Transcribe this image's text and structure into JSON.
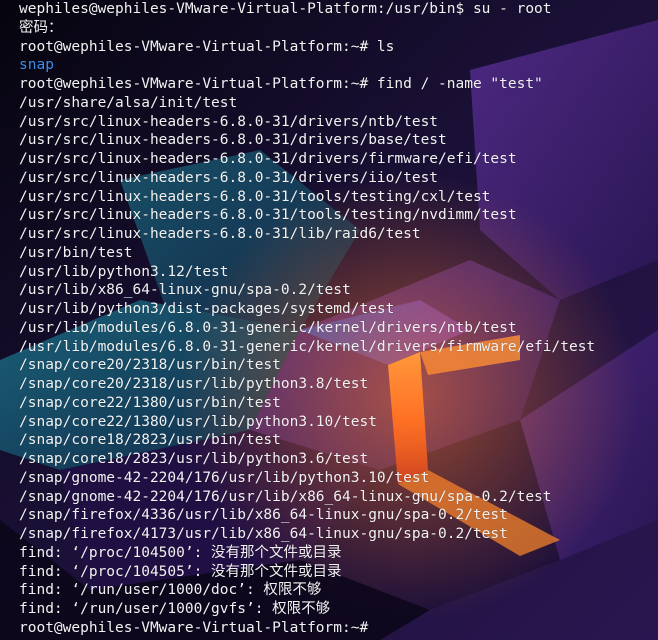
{
  "terminal": {
    "lines": [
      {
        "text": "wephiles@wephiles-VMware-Virtual-Platform:/usr/bin$ su - root"
      },
      {
        "text": "密码："
      },
      {
        "text": "root@wephiles-VMware-Virtual-Platform:~# ls"
      },
      {
        "text": "snap",
        "kind": "dir"
      },
      {
        "text": "root@wephiles-VMware-Virtual-Platform:~# find / -name \"test\""
      },
      {
        "text": "/usr/share/alsa/init/test"
      },
      {
        "text": "/usr/src/linux-headers-6.8.0-31/drivers/ntb/test"
      },
      {
        "text": "/usr/src/linux-headers-6.8.0-31/drivers/base/test"
      },
      {
        "text": "/usr/src/linux-headers-6.8.0-31/drivers/firmware/efi/test"
      },
      {
        "text": "/usr/src/linux-headers-6.8.0-31/drivers/iio/test"
      },
      {
        "text": "/usr/src/linux-headers-6.8.0-31/tools/testing/cxl/test"
      },
      {
        "text": "/usr/src/linux-headers-6.8.0-31/tools/testing/nvdimm/test"
      },
      {
        "text": "/usr/src/linux-headers-6.8.0-31/lib/raid6/test"
      },
      {
        "text": "/usr/bin/test"
      },
      {
        "text": "/usr/lib/python3.12/test"
      },
      {
        "text": "/usr/lib/x86_64-linux-gnu/spa-0.2/test"
      },
      {
        "text": "/usr/lib/python3/dist-packages/systemd/test"
      },
      {
        "text": "/usr/lib/modules/6.8.0-31-generic/kernel/drivers/ntb/test"
      },
      {
        "text": "/usr/lib/modules/6.8.0-31-generic/kernel/drivers/firmware/efi/test"
      },
      {
        "text": "/snap/core20/2318/usr/bin/test"
      },
      {
        "text": "/snap/core20/2318/usr/lib/python3.8/test"
      },
      {
        "text": "/snap/core22/1380/usr/bin/test"
      },
      {
        "text": "/snap/core22/1380/usr/lib/python3.10/test"
      },
      {
        "text": "/snap/core18/2823/usr/bin/test"
      },
      {
        "text": "/snap/core18/2823/usr/lib/python3.6/test"
      },
      {
        "text": "/snap/gnome-42-2204/176/usr/lib/python3.10/test"
      },
      {
        "text": "/snap/gnome-42-2204/176/usr/lib/x86_64-linux-gnu/spa-0.2/test"
      },
      {
        "text": "/snap/firefox/4336/usr/lib/x86_64-linux-gnu/spa-0.2/test"
      },
      {
        "text": "/snap/firefox/4173/usr/lib/x86_64-linux-gnu/spa-0.2/test"
      },
      {
        "text": "find: ‘/proc/104500’: 没有那个文件或目录"
      },
      {
        "text": "find: ‘/proc/104505’: 没有那个文件或目录"
      },
      {
        "text": "find: ‘/run/user/1000/doc’: 权限不够"
      },
      {
        "text": "find: ‘/run/user/1000/gvfs’: 权限不够"
      },
      {
        "text": "root@wephiles-VMware-Virtual-Platform:~#"
      }
    ]
  },
  "colors": {
    "text": "#f2f2f2",
    "directory": "#3b8eea",
    "background": "#120a24"
  }
}
